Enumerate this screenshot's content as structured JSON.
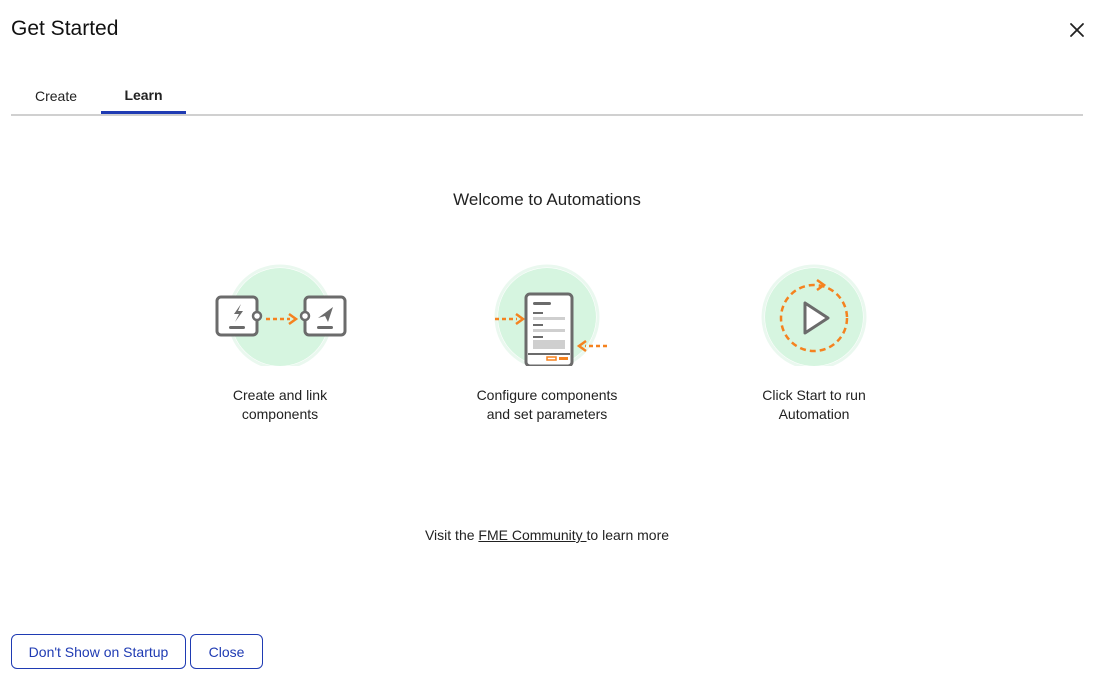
{
  "dialog": {
    "title": "Get Started",
    "close_icon": "close-icon"
  },
  "tabs": [
    {
      "label": "Create",
      "active": false
    },
    {
      "label": "Learn",
      "active": true
    }
  ],
  "learn": {
    "heading": "Welcome to Automations",
    "steps": [
      {
        "icon": "link-components-icon",
        "caption": "Create and link\ncomponents"
      },
      {
        "icon": "configure-parameters-icon",
        "caption": "Configure components\nand set parameters"
      },
      {
        "icon": "start-automation-icon",
        "caption": "Click Start to run\nAutomation"
      }
    ],
    "visit_prefix": "Visit the ",
    "visit_link": "FME Community ",
    "visit_suffix": "to learn more"
  },
  "footer": {
    "dont_show_label": "Don't Show on Startup",
    "close_label": "Close"
  },
  "colors": {
    "accent": "#1f3bb3",
    "illustration_orange": "#f5821f",
    "illustration_green": "#d6f5e0",
    "illustration_gray": "#6b6b6b"
  }
}
